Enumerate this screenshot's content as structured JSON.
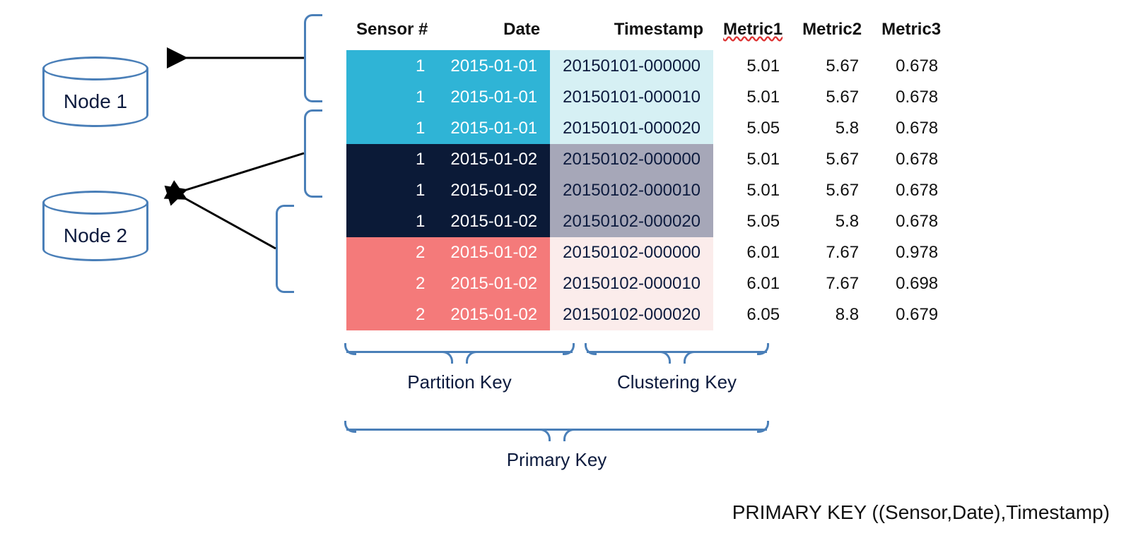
{
  "nodes": {
    "n1": "Node 1",
    "n2": "Node 2"
  },
  "headers": {
    "sensor": "Sensor #",
    "date": "Date",
    "ts": "Timestamp",
    "m1": "Metric1",
    "m2": "Metric2",
    "m3": "Metric3"
  },
  "groups": [
    {
      "color": "cyan",
      "rows": [
        {
          "sensor": "1",
          "date": "2015-01-01",
          "ts": "20150101-000000",
          "m1": "5.01",
          "m2": "5.67",
          "m3": "0.678"
        },
        {
          "sensor": "1",
          "date": "2015-01-01",
          "ts": "20150101-000010",
          "m1": "5.01",
          "m2": "5.67",
          "m3": "0.678"
        },
        {
          "sensor": "1",
          "date": "2015-01-01",
          "ts": "20150101-000020",
          "m1": "5.05",
          "m2": "5.8",
          "m3": "0.678"
        }
      ]
    },
    {
      "color": "navy",
      "rows": [
        {
          "sensor": "1",
          "date": "2015-01-02",
          "ts": "20150102-000000",
          "m1": "5.01",
          "m2": "5.67",
          "m3": "0.678"
        },
        {
          "sensor": "1",
          "date": "2015-01-02",
          "ts": "20150102-000010",
          "m1": "5.01",
          "m2": "5.67",
          "m3": "0.678"
        },
        {
          "sensor": "1",
          "date": "2015-01-02",
          "ts": "20150102-000020",
          "m1": "5.05",
          "m2": "5.8",
          "m3": "0.678"
        }
      ]
    },
    {
      "color": "red",
      "rows": [
        {
          "sensor": "2",
          "date": "2015-01-02",
          "ts": "20150102-000000",
          "m1": "6.01",
          "m2": "7.67",
          "m3": "0.978"
        },
        {
          "sensor": "2",
          "date": "2015-01-02",
          "ts": "20150102-000010",
          "m1": "6.01",
          "m2": "7.67",
          "m3": "0.698"
        },
        {
          "sensor": "2",
          "date": "2015-01-02",
          "ts": "20150102-000020",
          "m1": "6.05",
          "m2": "8.8",
          "m3": "0.679"
        }
      ]
    }
  ],
  "labels": {
    "partition": "Partition Key",
    "cluster": "Clustering Key",
    "primary": "Primary Key",
    "pkdef": "PRIMARY KEY ((Sensor,Date),Timestamp)"
  },
  "chart_data": {
    "type": "table",
    "title": "Cassandra partitioning example: sensor readings distributed across nodes",
    "columns": [
      "Sensor #",
      "Date",
      "Timestamp",
      "Metric1",
      "Metric2",
      "Metric3"
    ],
    "partition_key_columns": [
      "Sensor #",
      "Date"
    ],
    "clustering_key_columns": [
      "Timestamp"
    ],
    "primary_key_definition": "PRIMARY KEY ((Sensor,Date),Timestamp)",
    "node_assignment": {
      "Node 1": [
        "partition 1"
      ],
      "Node 2": [
        "partition 2",
        "partition 3"
      ]
    },
    "partitions": [
      {
        "partition": 1,
        "node": "Node 1",
        "sensor": 1,
        "date": "2015-01-01",
        "rows": [
          {
            "timestamp": "20150101-000000",
            "Metric1": 5.01,
            "Metric2": 5.67,
            "Metric3": 0.678
          },
          {
            "timestamp": "20150101-000010",
            "Metric1": 5.01,
            "Metric2": 5.67,
            "Metric3": 0.678
          },
          {
            "timestamp": "20150101-000020",
            "Metric1": 5.05,
            "Metric2": 5.8,
            "Metric3": 0.678
          }
        ]
      },
      {
        "partition": 2,
        "node": "Node 2",
        "sensor": 1,
        "date": "2015-01-02",
        "rows": [
          {
            "timestamp": "20150102-000000",
            "Metric1": 5.01,
            "Metric2": 5.67,
            "Metric3": 0.678
          },
          {
            "timestamp": "20150102-000010",
            "Metric1": 5.01,
            "Metric2": 5.67,
            "Metric3": 0.678
          },
          {
            "timestamp": "20150102-000020",
            "Metric1": 5.05,
            "Metric2": 5.8,
            "Metric3": 0.678
          }
        ]
      },
      {
        "partition": 3,
        "node": "Node 2",
        "sensor": 2,
        "date": "2015-01-02",
        "rows": [
          {
            "timestamp": "20150102-000000",
            "Metric1": 6.01,
            "Metric2": 7.67,
            "Metric3": 0.978
          },
          {
            "timestamp": "20150102-000010",
            "Metric1": 6.01,
            "Metric2": 7.67,
            "Metric3": 0.698
          },
          {
            "timestamp": "20150102-000020",
            "Metric1": 6.05,
            "Metric2": 8.8,
            "Metric3": 0.679
          }
        ]
      }
    ]
  }
}
